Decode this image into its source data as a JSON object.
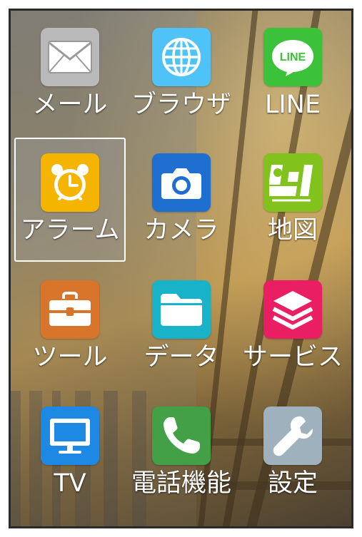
{
  "apps": [
    {
      "label": "メール",
      "icon": "mail-icon",
      "color": "#b9b9b9"
    },
    {
      "label": "ブラウザ",
      "icon": "globe-icon",
      "color": "#4fc3f7"
    },
    {
      "label": "LINE",
      "icon": "line-icon",
      "color": "#3cc13b",
      "icon_text": "LINE"
    },
    {
      "label": "アラーム",
      "icon": "alarm-clock-icon",
      "color": "#f5b400",
      "selected": true
    },
    {
      "label": "カメラ",
      "icon": "camera-icon",
      "color": "#1e6fd0"
    },
    {
      "label": "地図",
      "icon": "map-icon",
      "color": "#82c21c"
    },
    {
      "label": "ツール",
      "icon": "toolbox-icon",
      "color": "#d9752a"
    },
    {
      "label": "データ",
      "icon": "folder-icon",
      "color": "#19b3c9"
    },
    {
      "label": "サービス",
      "icon": "layers-icon",
      "color": "#e91e63"
    },
    {
      "label": "TV",
      "icon": "tv-icon",
      "color": "#1e88e5"
    },
    {
      "label": "電話機能",
      "icon": "phone-icon",
      "color": "#43a047"
    },
    {
      "label": "設定",
      "icon": "wrench-icon",
      "color": "#9fb1bd"
    }
  ]
}
